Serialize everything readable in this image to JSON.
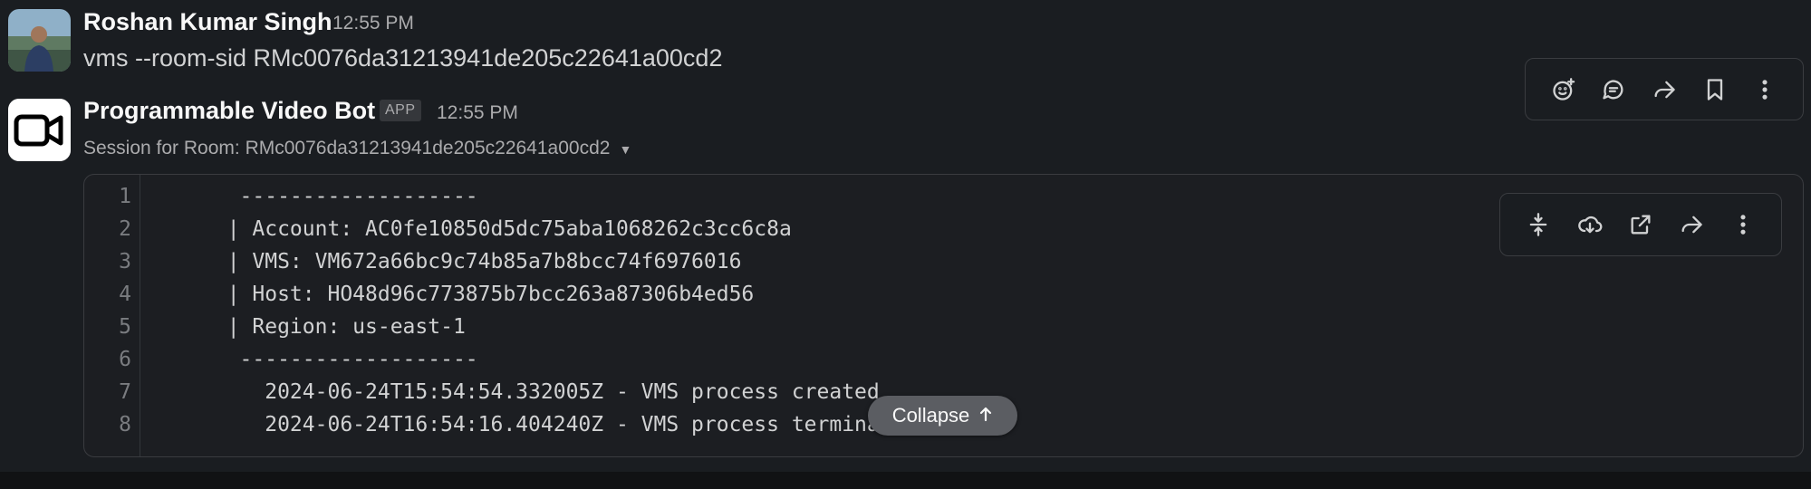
{
  "messages": [
    {
      "author": "Roshan Kumar Singh",
      "time": "12:55 PM",
      "text": "vms --room-sid RMc0076da31213941de205c22641a00cd2"
    },
    {
      "author": "Programmable Video Bot",
      "badge": "APP",
      "time": "12:55 PM",
      "subtitle": "Session for Room: RMc0076da31213941de205c22641a00cd2"
    }
  ],
  "message_toolbar": {
    "icons": [
      "add-reaction-icon",
      "reply-in-thread-icon",
      "forward-icon",
      "bookmark-icon",
      "more-actions-icon"
    ]
  },
  "code_toolbar": {
    "icons": [
      "collapse-lines-icon",
      "download-icon",
      "open-external-icon",
      "share-icon",
      "more-icon"
    ]
  },
  "code_block": {
    "lines": [
      {
        "num": "1",
        "text": "   -------------------"
      },
      {
        "num": "2",
        "text": "  | Account: AC0fe10850d5dc75aba1068262c3cc6c8a"
      },
      {
        "num": "3",
        "text": "  | VMS: VM672a66bc9c74b85a7b8bcc74f6976016"
      },
      {
        "num": "4",
        "text": "  | Host: HO48d96c773875b7bcc263a87306b4ed56"
      },
      {
        "num": "5",
        "text": "  | Region: us-east-1"
      },
      {
        "num": "6",
        "text": "   -------------------"
      },
      {
        "num": "7",
        "text": "     2024-06-24T15:54:54.332005Z - VMS process created"
      },
      {
        "num": "8",
        "text": "     2024-06-24T16:54:16.404240Z - VMS process terminated"
      }
    ],
    "collapse_label": "Collapse"
  },
  "colors": {
    "background": "#1a1d21",
    "text": "#d1d2d3",
    "muted": "#ababad"
  }
}
